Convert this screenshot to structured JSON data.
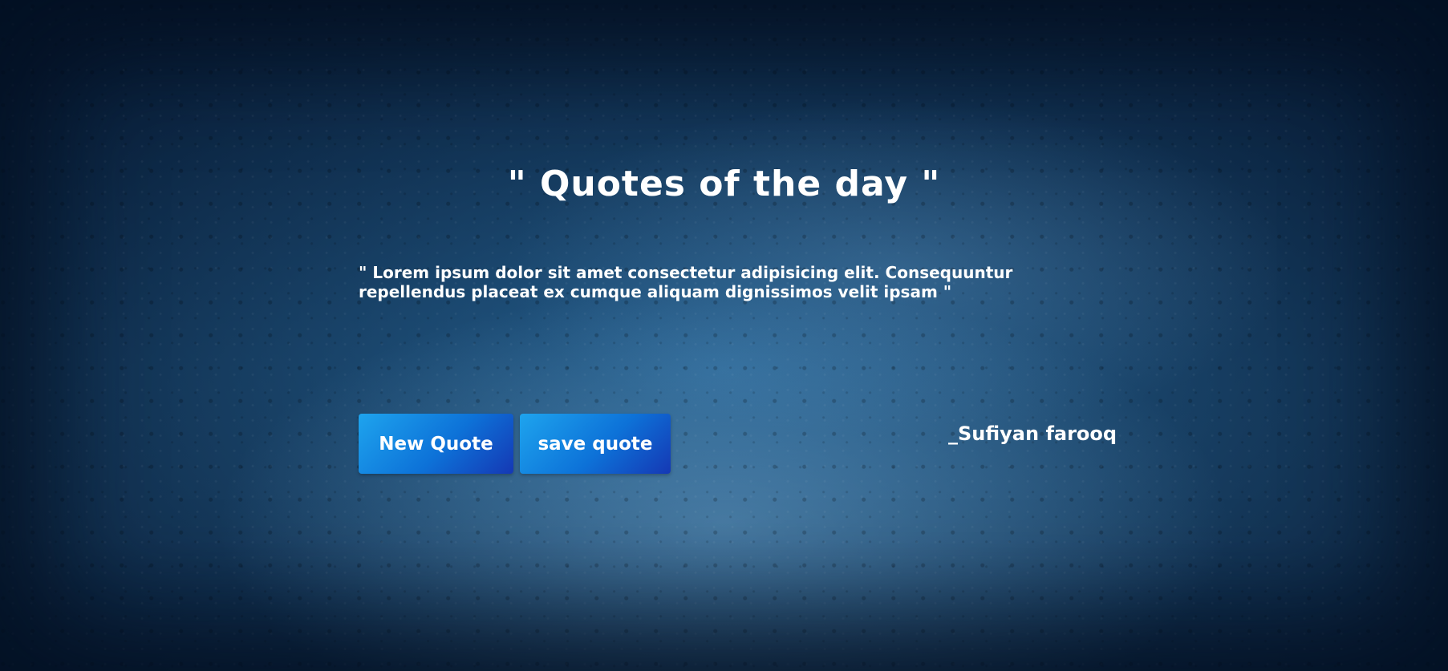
{
  "page": {
    "title": "\" Quotes of the day \"",
    "quote_text": "\" Lorem ipsum dolor sit amet consectetur adipisicing elit. Consequuntur repellendus placeat ex cumque aliquam dignissimos velit ipsam \"",
    "author": "_Sufiyan farooq"
  },
  "buttons": {
    "new_quote_label": "New Quote",
    "save_quote_label": "save quote"
  },
  "colors": {
    "background": "#1c4d77",
    "text": "#ffffff",
    "button_gradient_start": "#1ea4ee",
    "button_gradient_end": "#1538b4"
  }
}
